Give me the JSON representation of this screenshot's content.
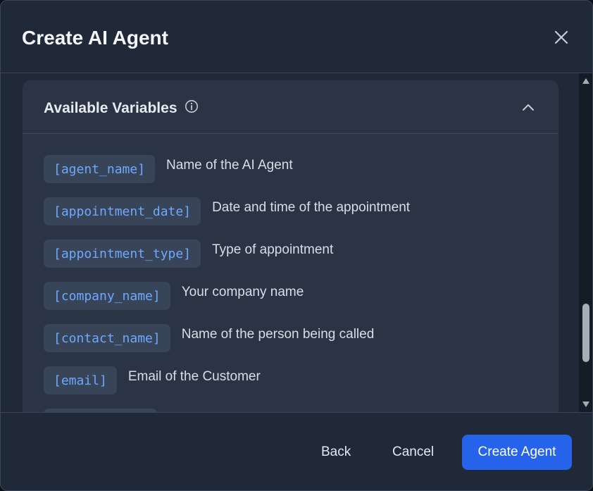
{
  "modal": {
    "title": "Create AI Agent"
  },
  "panel": {
    "title": "Available Variables"
  },
  "variables": [
    {
      "token": "[agent_name]",
      "description": "Name of the AI Agent"
    },
    {
      "token": "[appointment_date]",
      "description": "Date and time of the appointment"
    },
    {
      "token": "[appointment_type]",
      "description": "Type of appointment"
    },
    {
      "token": "[company_name]",
      "description": "Your company name"
    },
    {
      "token": "[contact_name]",
      "description": "Name of the person being called"
    },
    {
      "token": "[email]",
      "description": "Email of the Customer"
    }
  ],
  "footer": {
    "back_label": "Back",
    "cancel_label": "Cancel",
    "primary_label": "Create Agent"
  },
  "colors": {
    "accent": "#2563eb",
    "variable_token": "#6ea8ff",
    "modal_bg": "#1f2938",
    "panel_bg": "#2a3444"
  },
  "icons": {
    "close": "close-icon",
    "info": "info-icon",
    "collapse": "chevron-up-icon"
  }
}
